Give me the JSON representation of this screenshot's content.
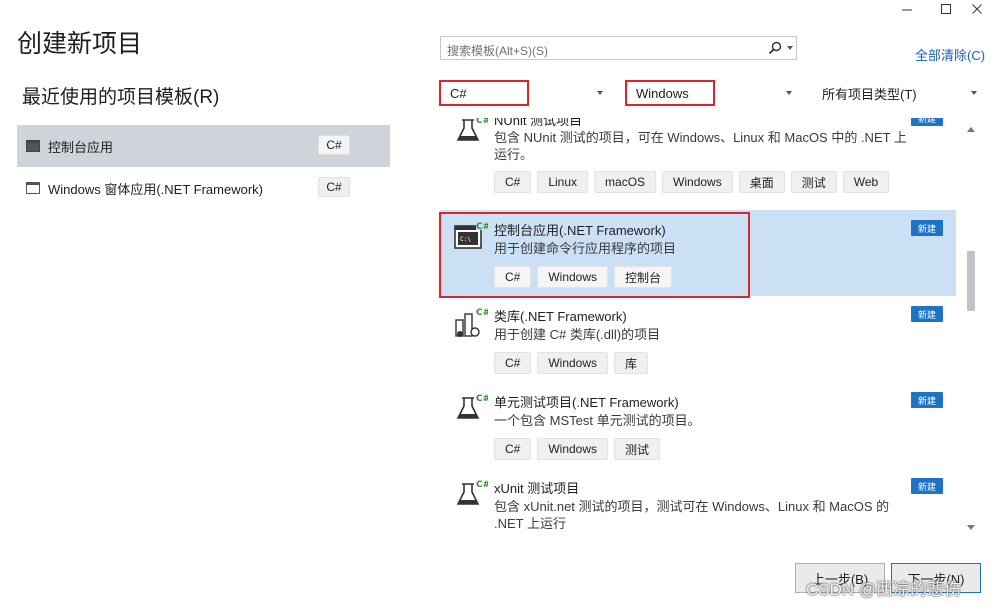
{
  "window": {
    "title": "创建新项目",
    "controls": [
      "minimize-icon",
      "maximize-icon",
      "close-icon"
    ]
  },
  "recent": {
    "title": "最近使用的项目模板(R)",
    "items": [
      {
        "label": "控制台应用",
        "lang": "C#",
        "selected": true
      },
      {
        "label": "Windows 窗体应用(.NET Framework)",
        "lang": "C#",
        "selected": false
      }
    ]
  },
  "search": {
    "placeholder": "搜索模板(Alt+S)(S)",
    "clear_all": "全部清除(C)"
  },
  "filters": {
    "language": "C#",
    "platform": "Windows",
    "project_type": "所有项目类型(T)"
  },
  "templates": [
    {
      "name": "NUnit 测试项目",
      "desc": "包含 NUnit 测试的项目，可在 Windows、Linux 和 MacOS 中的 .NET 上运行。",
      "tags": [
        "C#",
        "Linux",
        "macOS",
        "Windows",
        "桌面",
        "测试",
        "Web"
      ],
      "badge": "新建",
      "icon": "flask-icon",
      "selected": false
    },
    {
      "name": "控制台应用(.NET Framework)",
      "desc": "用于创建命令行应用程序的项目",
      "tags": [
        "C#",
        "Windows",
        "控制台"
      ],
      "badge": "新建",
      "icon": "console-icon",
      "selected": true
    },
    {
      "name": "类库(.NET Framework)",
      "desc": "用于创建 C# 类库(.dll)的项目",
      "tags": [
        "C#",
        "Windows",
        "库"
      ],
      "badge": "新建",
      "icon": "class-library-icon",
      "selected": false
    },
    {
      "name": "单元测试项目(.NET Framework)",
      "desc": "一个包含 MSTest 单元测试的项目。",
      "tags": [
        "C#",
        "Windows",
        "测试"
      ],
      "badge": "新建",
      "icon": "flask-icon",
      "selected": false
    },
    {
      "name": "xUnit 测试项目",
      "desc": "包含 xUnit.net 测试的项目，测试可在 Windows、Linux 和 MacOS 的 .NET 上运行",
      "tags": [],
      "badge": "新建",
      "icon": "flask-icon",
      "selected": false
    }
  ],
  "buttons": {
    "back": "上一步(B)",
    "next": "下一步(N)"
  },
  "watermark": "CSDN @西凉的悲伤",
  "colors": {
    "accent": "#1f73c7",
    "highlight_box": "#d9262b",
    "selected_row": "#cce0f5",
    "recent_selected": "#cfd3da"
  }
}
